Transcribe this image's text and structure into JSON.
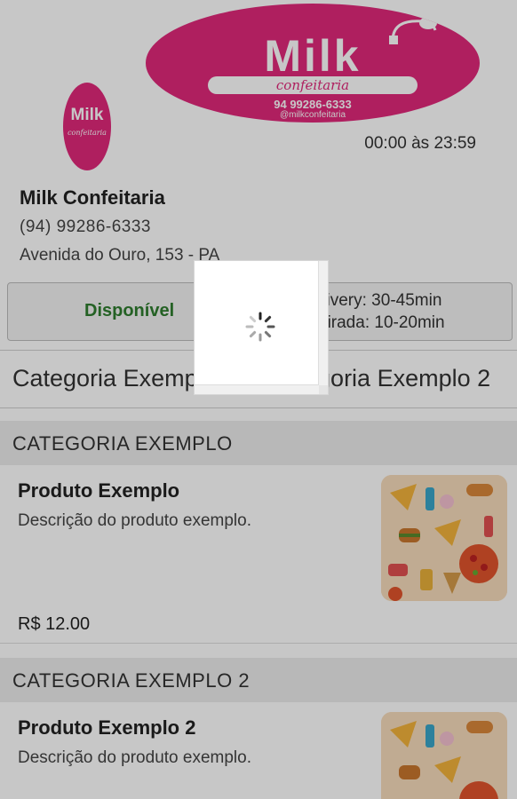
{
  "header": {
    "banner": {
      "brand": "Milk",
      "subtitle": "confeitaria",
      "phone": "94 99286-6333",
      "instagram": "@milkconfeitaria"
    },
    "logo": {
      "brand": "Milk",
      "subtitle": "confeitaria"
    },
    "hours": "00:00 às 23:59"
  },
  "store": {
    "name": "Milk Confeitaria",
    "phone": "(94) 99286-6333",
    "address": "Avenida do Ouro, 153 - PA"
  },
  "status": {
    "label": "Disponível",
    "delivery": "Delivery: 30-45min",
    "pickup": "Retirada: 10-20min"
  },
  "tabs": [
    {
      "label": "Categoria Exemplo"
    },
    {
      "label": "Categoria Exemplo 2"
    }
  ],
  "sections": [
    {
      "title": "CATEGORIA EXEMPLO",
      "product": {
        "name": "Produto Exemplo",
        "description": "Descrição do produto exemplo.",
        "price": "R$ 12.00"
      }
    },
    {
      "title": "CATEGORIA EXEMPLO 2",
      "product": {
        "name": "Produto Exemplo 2",
        "description": "Descrição do produto exemplo."
      }
    }
  ],
  "colors": {
    "brand": "#e0287a",
    "available": "#2f7d2f",
    "overlay": "rgba(0,0,0,0.22)"
  },
  "icons": [
    "loading-spinner-icon",
    "cup-icon"
  ]
}
